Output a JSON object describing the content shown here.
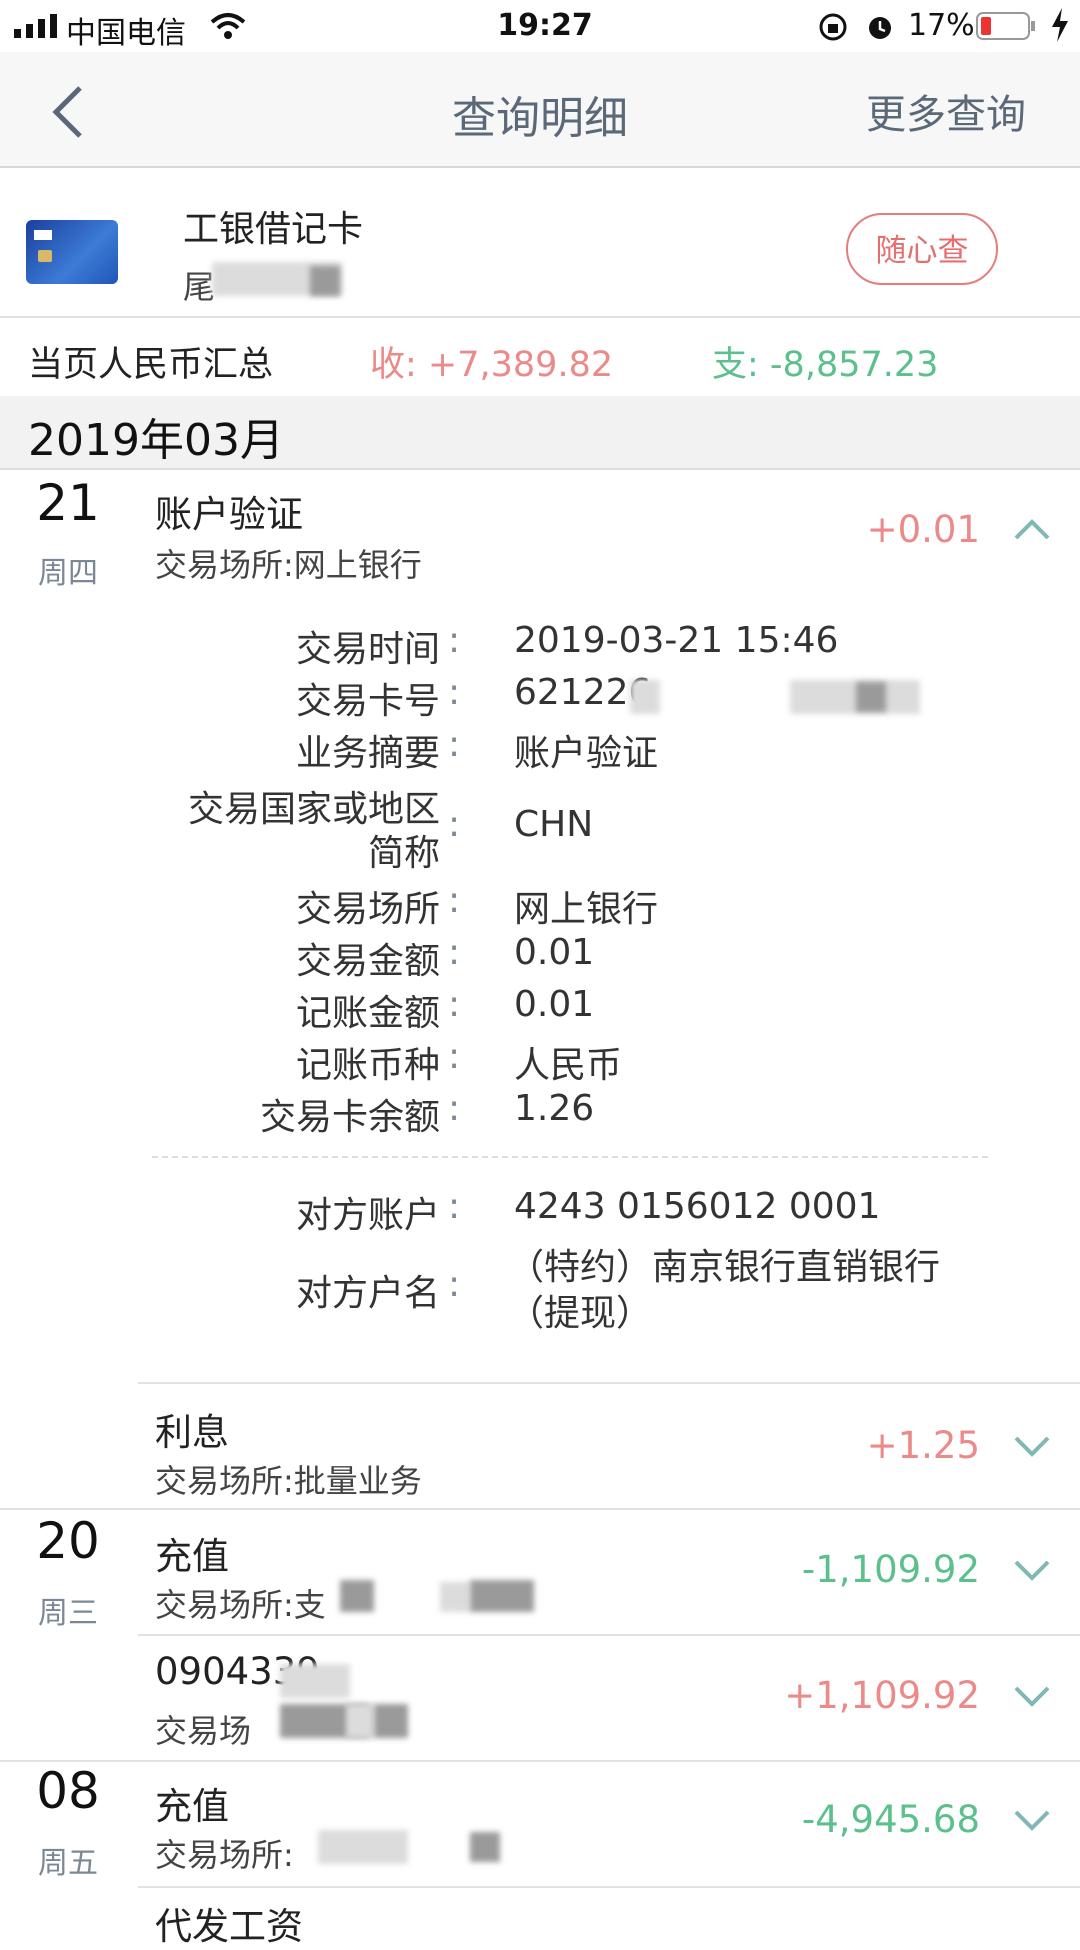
{
  "status_bar": {
    "carrier": "中国电信",
    "time": "19:27",
    "battery": "17%"
  },
  "nav": {
    "title": "查询明细",
    "more": "更多查询"
  },
  "card": {
    "name": "工银借记卡",
    "tail_prefix": "尾",
    "random_query": "随心查"
  },
  "summary": {
    "label": "当页人民币汇总",
    "income": "收: +7,389.82",
    "expense": "支: -8,857.23"
  },
  "month": "2019年03月",
  "transactions": [
    {
      "day": "21",
      "weekday": "周四",
      "title": "账户验证",
      "place": "交易场所:网上银行",
      "amount": "+0.01"
    },
    {
      "title": "利息",
      "place": "交易场所:批量业务",
      "amount": "+1.25"
    },
    {
      "day": "20",
      "weekday": "周三",
      "title": "充值",
      "place": "交易场所:支",
      "amount": "-1,109.92"
    },
    {
      "title": "0904339",
      "place": "交易场",
      "amount": "+1,109.92"
    },
    {
      "day": "08",
      "weekday": "周五",
      "title": "充值",
      "place": "交易场所:",
      "amount": "-4,945.68"
    },
    {
      "title": "代发工资"
    }
  ],
  "detail": {
    "rows": [
      {
        "key": "交易时间",
        "value": "2019-03-21 15:46"
      },
      {
        "key": "交易卡号",
        "value": "621226"
      },
      {
        "key": "业务摘要",
        "value": "账户验证"
      },
      {
        "key": "交易国家或地区",
        "key2": "简称",
        "value": "CHN"
      },
      {
        "key": "交易场所",
        "value": "网上银行"
      },
      {
        "key": "交易金额",
        "value": "0.01"
      },
      {
        "key": "记账金额",
        "value": "0.01"
      },
      {
        "key": "记账币种",
        "value": "人民币"
      },
      {
        "key": "交易卡余额",
        "value": "1.26"
      }
    ],
    "counterparty_account_label": "对方账户",
    "counterparty_account": "4243 0156012 0001",
    "counterparty_name_label": "对方户名",
    "counterparty_name_1": "（特约）南京银行直销银行",
    "counterparty_name_2": "（提现）",
    "colon": ":"
  }
}
